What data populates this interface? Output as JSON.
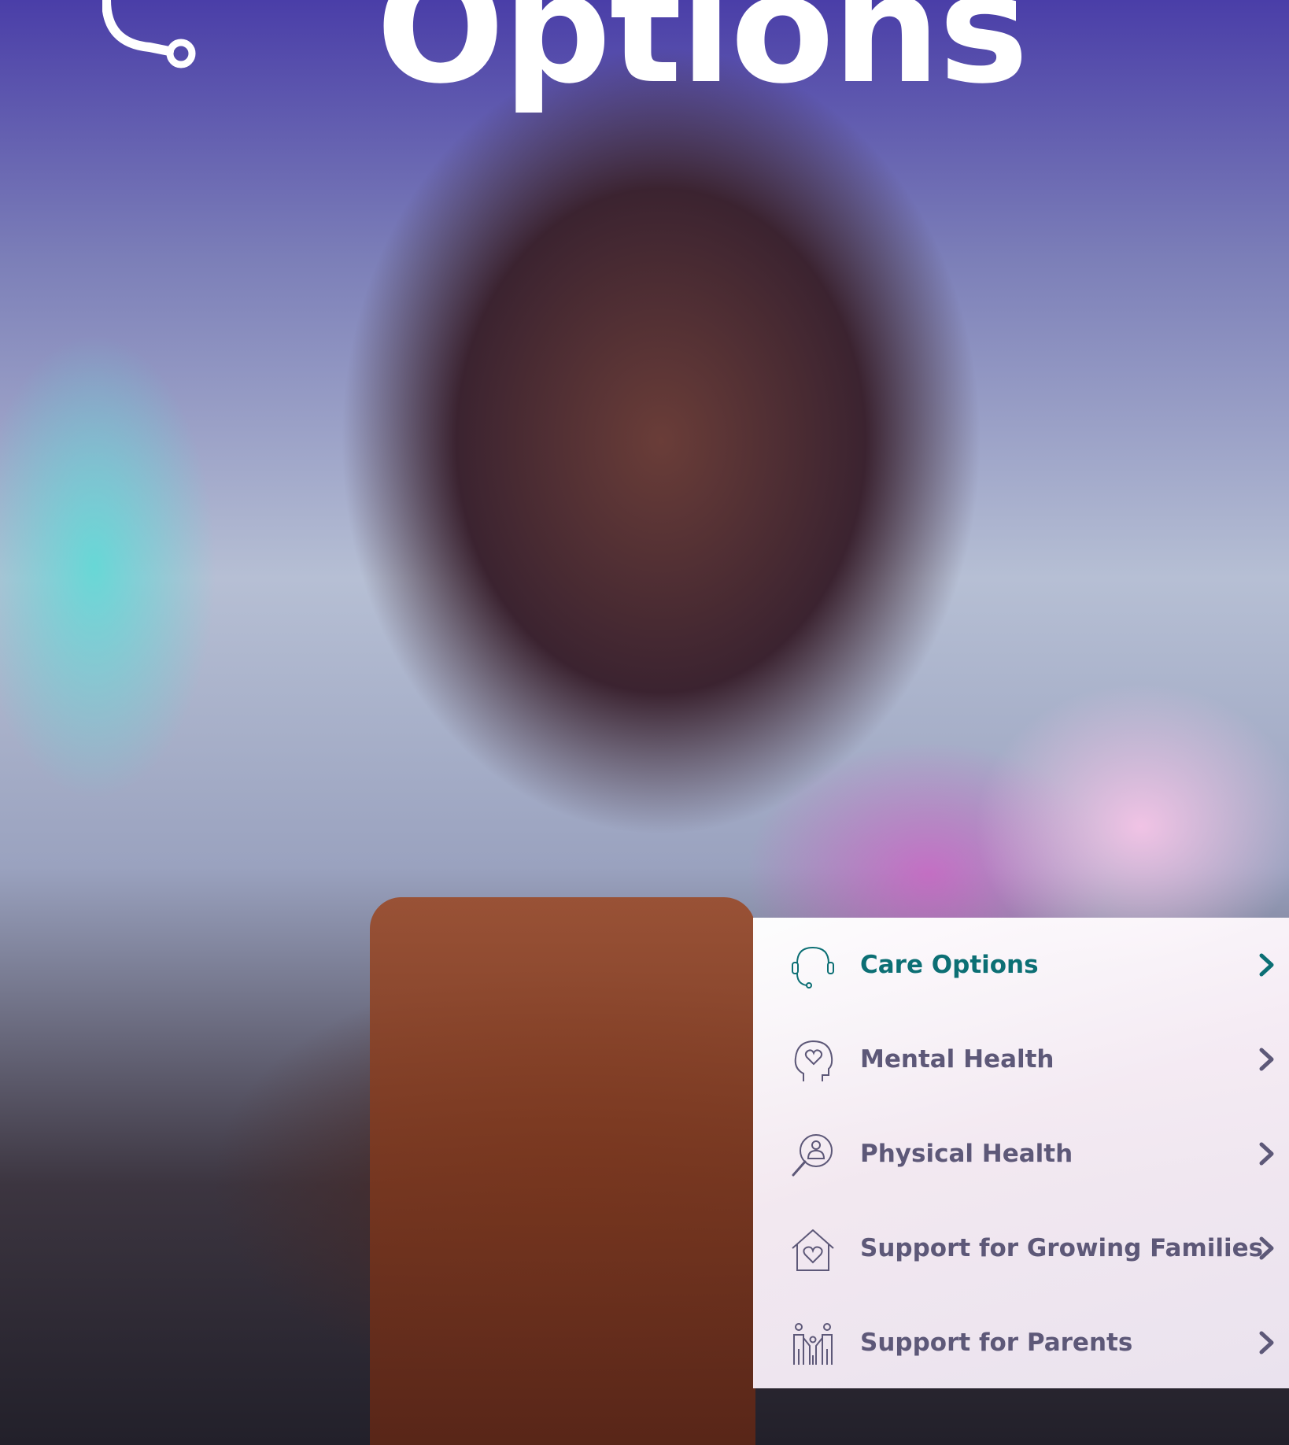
{
  "hero": {
    "title": "Options",
    "icon": "headset-icon"
  },
  "menu": {
    "items": [
      {
        "label": "Care Options",
        "icon": "headset-icon",
        "active": true,
        "color": "#0c6f74"
      },
      {
        "label": "Mental Health",
        "icon": "head-heart-icon",
        "active": false
      },
      {
        "label": "Physical Health",
        "icon": "magnifier-person-icon",
        "active": false
      },
      {
        "label": "Support for Growing Families",
        "icon": "house-heart-icon",
        "active": false
      },
      {
        "label": "Support for Parents",
        "icon": "parent-child-icon",
        "active": false
      }
    ],
    "text_color": "#5d5878",
    "active_color": "#0c6f74"
  }
}
